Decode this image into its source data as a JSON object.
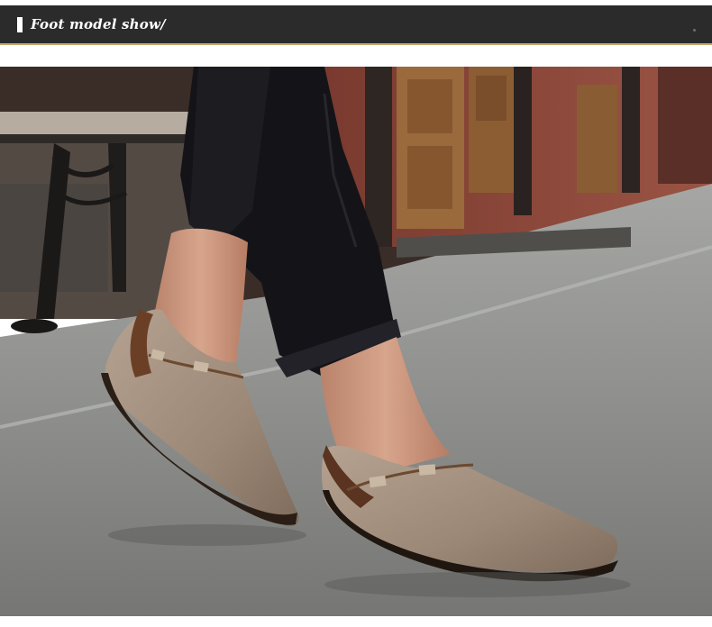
{
  "header": {
    "title": "Foot model show/",
    "accent_color": "#c9a66b",
    "background_color": "#2b2b2b"
  },
  "photo": {
    "subject": "model-wearing-suede-loafers",
    "colors": {
      "brick": "#8a4a3c",
      "door": "#9b6a3c",
      "pavement": "#8e8f8c",
      "trousers": "#151518",
      "skin": "#c9957c",
      "suede": "#a08c7a"
    }
  }
}
